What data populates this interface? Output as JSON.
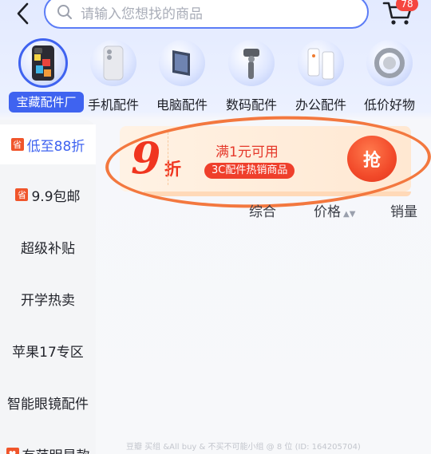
{
  "header": {
    "search_placeholder": "请输入您想找的商品",
    "cart_badge": "78"
  },
  "categories": [
    {
      "label": "宝藏配件厂",
      "active": true,
      "thumb_icon": "phone-case-thumb"
    },
    {
      "label": "手机配件",
      "active": false,
      "thumb_icon": "phone-thumb"
    },
    {
      "label": "电脑配件",
      "active": false,
      "thumb_icon": "laptop-thumb"
    },
    {
      "label": "数码配件",
      "active": false,
      "thumb_icon": "gimbal-thumb"
    },
    {
      "label": "办公配件",
      "active": false,
      "thumb_icon": "power-strip-thumb"
    },
    {
      "label": "低价好物",
      "active": false,
      "thumb_icon": "ring-holder-thumb"
    }
  ],
  "sidebar": {
    "items": [
      {
        "label": "低至88折",
        "active": true,
        "badge": "省"
      },
      {
        "label": "9.9包邮",
        "active": false,
        "badge": "省"
      },
      {
        "label": "超级补贴",
        "active": false
      },
      {
        "label": "开学热卖",
        "active": false
      },
      {
        "label": "苹果17专区",
        "active": false
      },
      {
        "label": "智能眼镜配件",
        "active": false
      },
      {
        "label": "有范明星款",
        "active": false
      }
    ]
  },
  "coupon": {
    "discount_number": "9",
    "discount_unit": "折",
    "condition": "满1元可用",
    "scope_tag": "3C配件热销商品",
    "grab_label": "抢"
  },
  "sort": {
    "items": [
      "综合",
      "价格",
      "销量"
    ]
  },
  "watermark": "豆瓣 买组 &All buy & 不买不可能小组 @ 8 位 (ID: 164205704)",
  "colors": {
    "accent": "#3f63f0",
    "coupon_red": "#f0351f",
    "highlight_circle": "#f3783f"
  }
}
